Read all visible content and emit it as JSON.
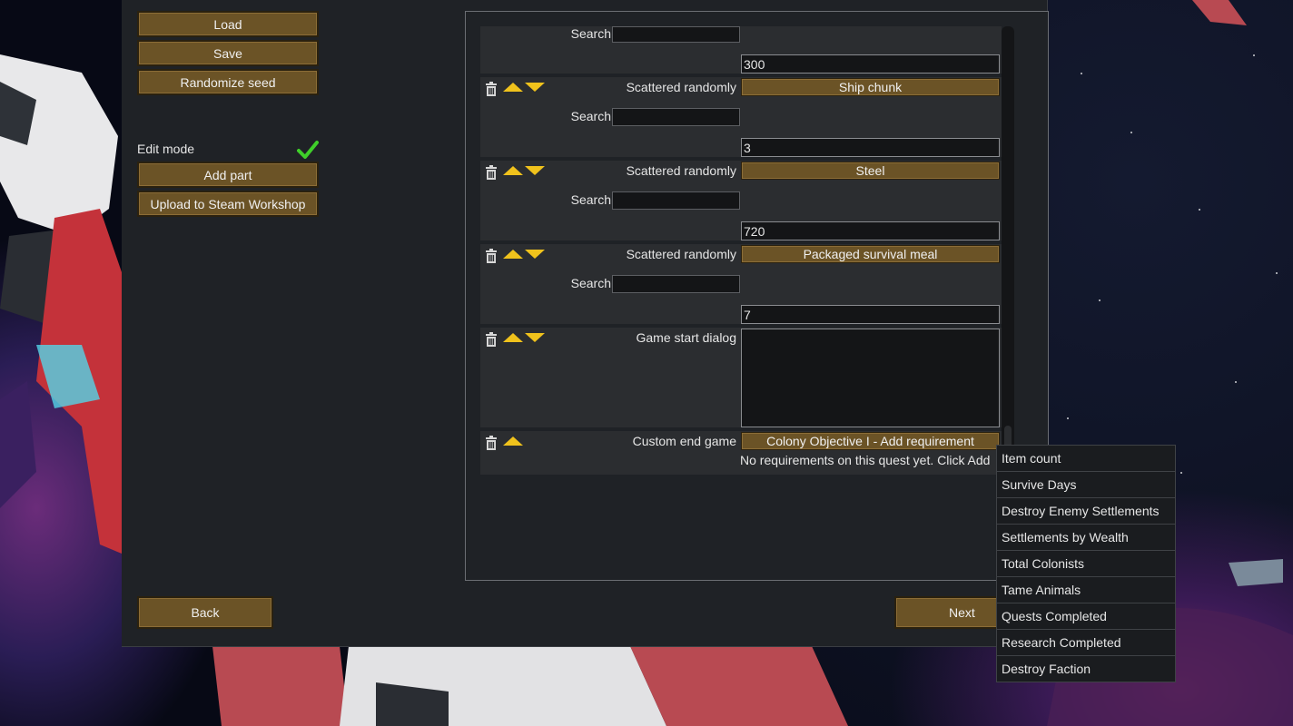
{
  "left_panel": {
    "load_label": "Load",
    "save_label": "Save",
    "randomize_label": "Randomize seed",
    "edit_mode_label": "Edit mode",
    "add_part_label": "Add part",
    "upload_label": "Upload to Steam Workshop"
  },
  "parts": {
    "top": {
      "search_label": "Search",
      "search_value": "",
      "count_value": "300"
    },
    "ship_chunk": {
      "label": "Scattered randomly",
      "item": "Ship chunk",
      "search_label": "Search",
      "search_value": "",
      "count_value": "3"
    },
    "steel": {
      "label": "Scattered randomly",
      "item": "Steel",
      "search_label": "Search",
      "search_value": "",
      "count_value": "720"
    },
    "meal": {
      "label": "Scattered randomly",
      "item": "Packaged survival meal",
      "search_label": "Search",
      "search_value": "",
      "count_value": "7"
    },
    "dialog": {
      "label": "Game start dialog",
      "text": ""
    },
    "end_game": {
      "label": "Custom end game",
      "objective_button": "Colony Objective I - Add requirement",
      "hint": "No requirements on this quest yet. Click Add"
    }
  },
  "icons": {
    "delete": "trash-icon",
    "move_up": "arrow-up-icon",
    "move_down": "arrow-down-icon",
    "checkmark": "checkmark-icon"
  },
  "colors": {
    "button": "#6b5326",
    "arrow": "#f0c21c",
    "checkmark": "#3fcf2a",
    "window": "#1f2226",
    "row": "#2b2d30"
  },
  "footer": {
    "back_label": "Back",
    "next_label": "Next"
  },
  "dropdown": {
    "items": [
      "Item count",
      "Survive Days",
      "Destroy Enemy Settlements",
      "Settlements by Wealth",
      "Total Colonists",
      "Tame Animals",
      "Quests Completed",
      "Research Completed",
      "Destroy Faction"
    ]
  }
}
